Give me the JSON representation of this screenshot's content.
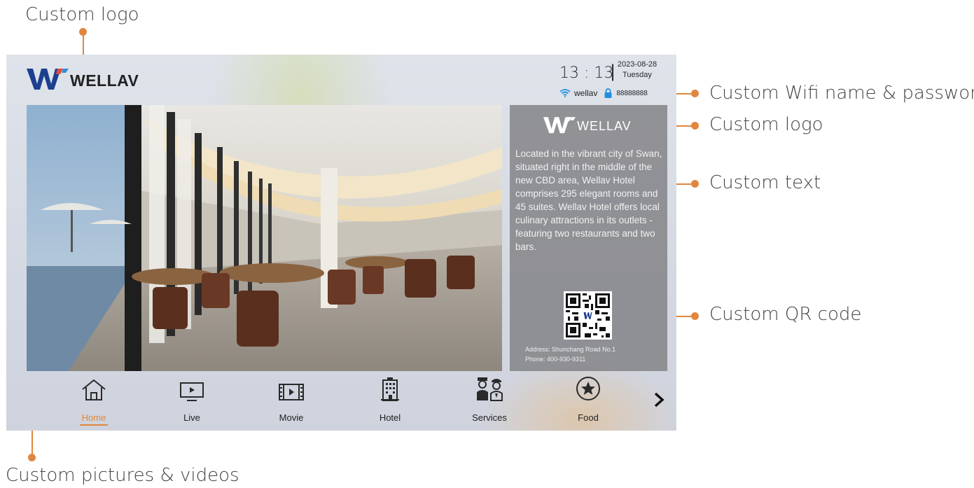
{
  "annotations": {
    "logo_top": "Custom logo",
    "wifi": "Custom Wifi name & password",
    "logo_side": "Custom logo",
    "text": "Custom text",
    "qr": "Custom QR code",
    "media": "Custom pictures & videos"
  },
  "header": {
    "brand": "WELLAV",
    "time": "13 : 13",
    "separator": "|",
    "date": "2023-08-28",
    "weekday": "Tuesday",
    "wifi_name": "wellav",
    "wifi_password": "88888888"
  },
  "info_panel": {
    "brand": "WELLAV",
    "description": "Located in the vibrant city of Swan, situated right in the middle of the new CBD area, Wellav Hotel comprises 295 elegant rooms and 45 suites. Wellav Hotel offers local culinary attractions in its outlets - featuring two restaurants and two bars.",
    "address": "Address: Shunchang Road No.1",
    "phone": "Phone: 400-930-9311"
  },
  "nav": {
    "items": [
      {
        "label": "Home",
        "icon": "home-icon",
        "active": true
      },
      {
        "label": "Live",
        "icon": "tv-icon",
        "active": false
      },
      {
        "label": "Movie",
        "icon": "film-icon",
        "active": false
      },
      {
        "label": "Hotel",
        "icon": "building-icon",
        "active": false
      },
      {
        "label": "Services",
        "icon": "staff-icon",
        "active": false
      },
      {
        "label": "Food",
        "icon": "star-icon",
        "active": false
      }
    ],
    "more_icon": "chevron-right-icon"
  },
  "colors": {
    "accent": "#e0873e",
    "logo_blue": "#1c3f8f",
    "panel": "#808084"
  }
}
